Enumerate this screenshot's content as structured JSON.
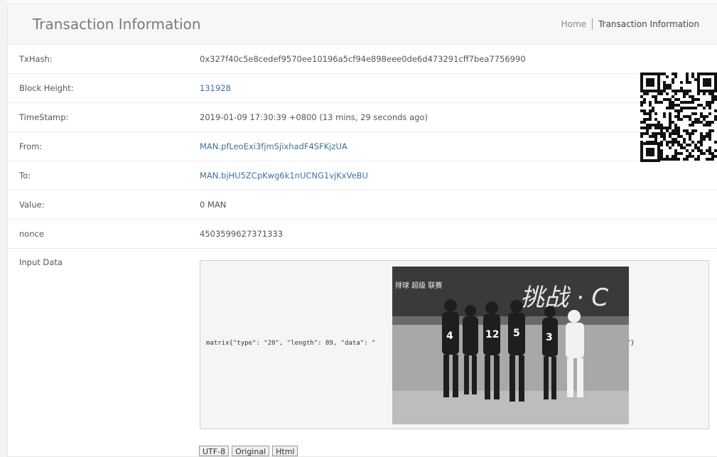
{
  "header": {
    "title": "Transaction Information",
    "breadcrumb": {
      "home": "Home",
      "current": "Transaction Information"
    }
  },
  "rows": [
    {
      "label": "TxHash:",
      "value": "0x327f40c5e8cedef9570ee10196a5cf94e898eee0de6d473291cff7bea7756990",
      "is_link": false
    },
    {
      "label": "Block Height:",
      "value": "131928",
      "is_link": true
    },
    {
      "label": "TimeStamp:",
      "value": "2019-01-09 17:30:39 +0800 (13 mins, 29 seconds ago)",
      "is_link": false
    },
    {
      "label": "From:",
      "value": "MAN.pfLeoExi3fjmSjixhadF4SFKjzUA",
      "is_link": true
    },
    {
      "label": "To:",
      "value": "MAN.bjHU5ZCpKwg6k1nUCNG1vjKxVeBU",
      "is_link": true
    },
    {
      "label": "Value:",
      "value": "0 MAN",
      "is_link": false
    },
    {
      "label": "nonce",
      "value": "4503599627371333",
      "is_link": false
    }
  ],
  "input_data": {
    "label": "Input Data",
    "code_prefix": "matrix{\"type\": \"20\", \"length\": 89, \"data\": \"",
    "code_suffix": "\"}",
    "photo_banner_left": "排球 超级 联赛",
    "photo_banner_right": "挑战 · C",
    "jersey_numbers": [
      "4",
      "12",
      "5",
      "3"
    ]
  },
  "encoding_buttons": [
    "UTF-8",
    "Original",
    "Html"
  ],
  "colors": {
    "link": "#3f6fa3",
    "border": "#ececec",
    "header_bg": "#f7f7f7"
  }
}
